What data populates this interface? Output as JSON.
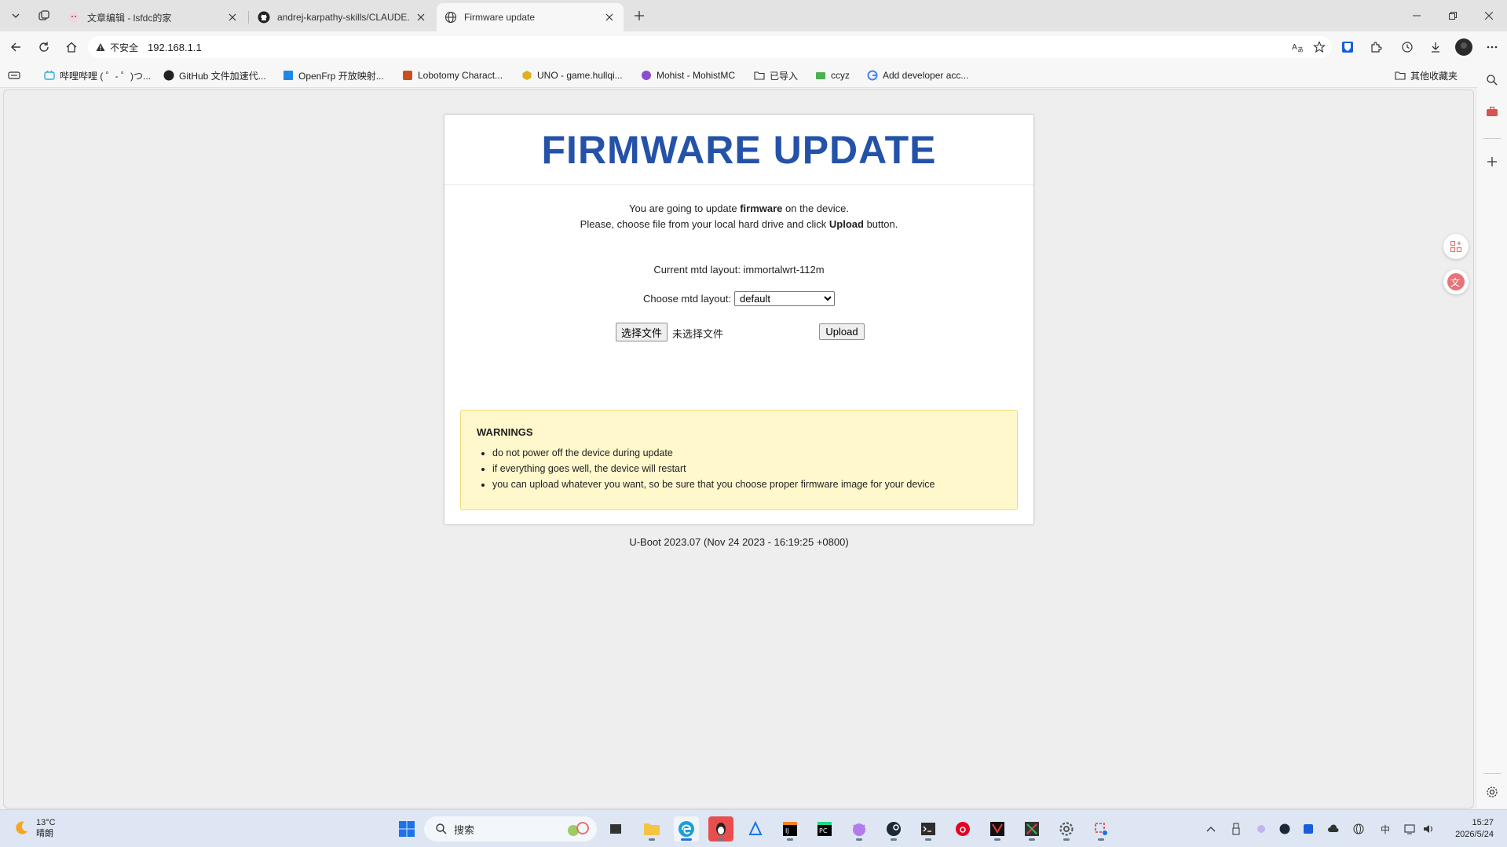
{
  "tabs": [
    {
      "title": "文章编辑 - lsfdc的家",
      "active": false
    },
    {
      "title": "andrej-karpathy-skills/CLAUDE.md",
      "active": false
    },
    {
      "title": "Firmware update",
      "active": true
    }
  ],
  "address": {
    "security_label": "不安全",
    "url": "192.168.1.1"
  },
  "bookmarks": [
    {
      "label": "哔哩哔哩 ( ゜- ゜)つ...",
      "icon": "bilibili-icon"
    },
    {
      "label": "GitHub 文件加速代...",
      "icon": "github-icon"
    },
    {
      "label": "OpenFrp 开放映射...",
      "icon": "openfrp-icon"
    },
    {
      "label": "Lobotomy Charact...",
      "icon": "lobotomy-icon"
    },
    {
      "label": "UNO - game.hullqi...",
      "icon": "uno-icon"
    },
    {
      "label": "Mohist - MohistMC",
      "icon": "mohist-icon"
    },
    {
      "label": "已导入",
      "icon": "folder-icon"
    },
    {
      "label": "ccyz",
      "icon": "ccyz-icon"
    },
    {
      "label": "Add developer acc...",
      "icon": "google-icon"
    }
  ],
  "other_bookmarks": "其他收藏夹",
  "page": {
    "heading": "FIRMWARE UPDATE",
    "intro": {
      "line1_pre": "You are going to update ",
      "line1_bold": "firmware",
      "line1_post": " on the device.",
      "line2_pre": "Please, choose file from your local hard drive and click ",
      "line2_bold": "Upload",
      "line2_post": " button."
    },
    "current_mtd_label": "Current mtd layout: immortalwrt-112m",
    "choose_mtd_label": "Choose mtd layout:",
    "mtd_selected": "default",
    "file_button": "选择文件",
    "file_status": "未选择文件",
    "upload_button": "Upload",
    "warnings": {
      "title": "WARNINGS",
      "items": [
        "do not power off the device during update",
        "if everything goes well, the device will restart",
        "you can upload whatever you want, so be sure that you choose proper firmware image for your device"
      ]
    },
    "footer": "U-Boot 2023.07 (Nov 24 2023 - 16:19:25 +0800)"
  },
  "taskbar": {
    "weather_temp": "13°C",
    "weather_desc": "晴朗",
    "search_placeholder": "搜索",
    "tray_ime": "中",
    "time": "15:27",
    "date": "2026/5/24"
  },
  "colors": {
    "heading": "#2452a8",
    "warning_bg": "#fff8cc",
    "warning_border": "#f0d97a"
  }
}
